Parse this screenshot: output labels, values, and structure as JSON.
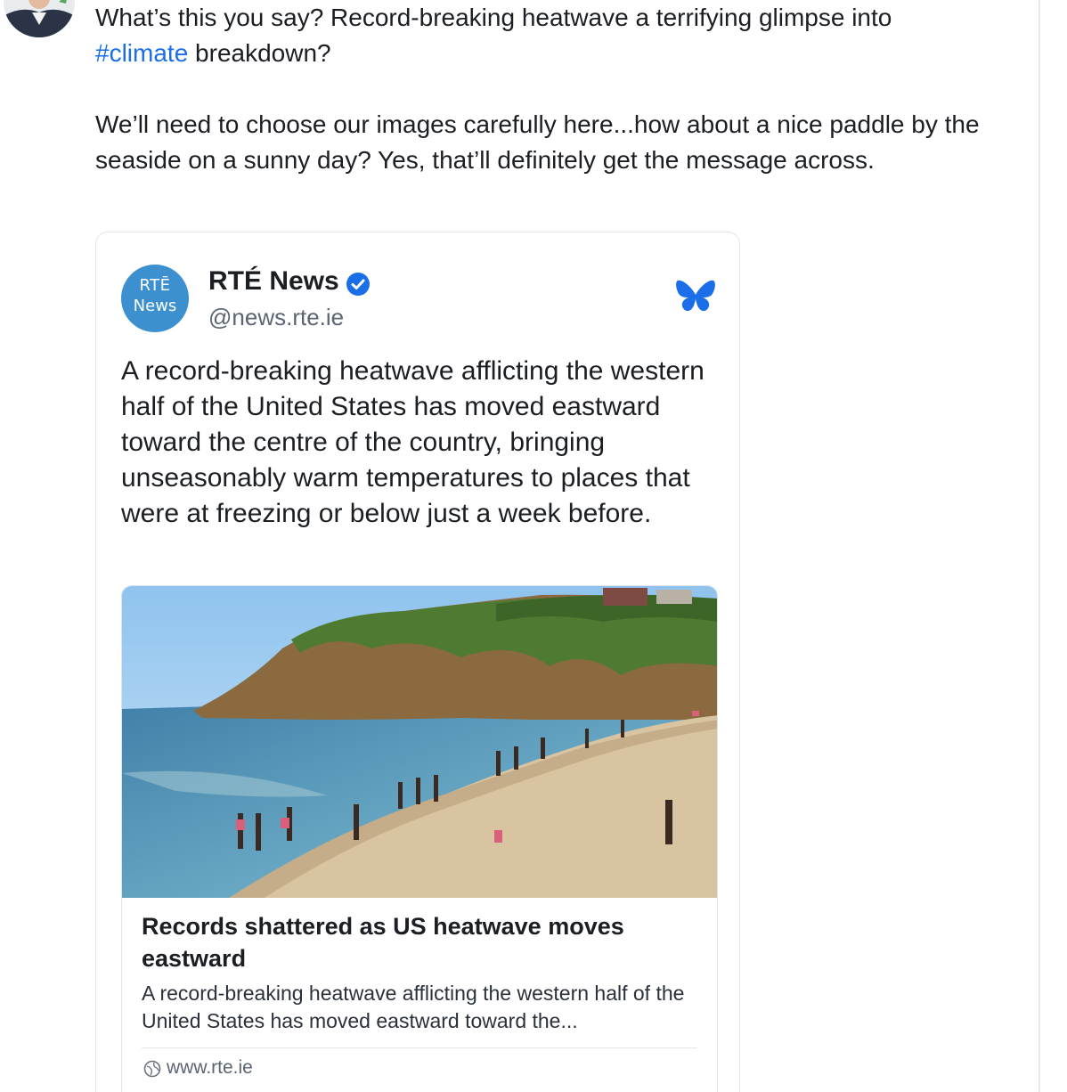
{
  "post": {
    "text_line1": "What’s this you say? Record-breaking heatwave a terrifying glimpse into",
    "hashtag": "#climate",
    "text_line2_rest": " breakdown?",
    "text_para2": "We’ll need to choose our images carefully here...how about a nice paddle by the seaside on a sunny day? Yes, that’ll definitely get the message across."
  },
  "embed": {
    "logo_line1": "RTĒ",
    "logo_line2": "News",
    "author_name": "RTÉ News",
    "handle": "@news.rte.ie",
    "text": "A record-breaking heatwave afflicting the western half of the United States has moved eastward toward the centre of the country, bringing unseasonably warm temperatures to places that were at freezing or below just a week before.",
    "link": {
      "title": "Records shattered as US heatwave moves eastward",
      "description": "A record-breaking heatwave afflicting the western half of the United States has moved eastward toward the...",
      "domain": "www.rte.ie"
    }
  },
  "icons": {
    "verified": "verified-badge-icon",
    "platform": "butterfly-icon",
    "globe": "globe-icon"
  },
  "colors": {
    "hashtag": "#1a6ee8",
    "rte_logo": "#3c90cf",
    "verified": "#1a6ee8",
    "butterfly": "#1a6ee8"
  }
}
